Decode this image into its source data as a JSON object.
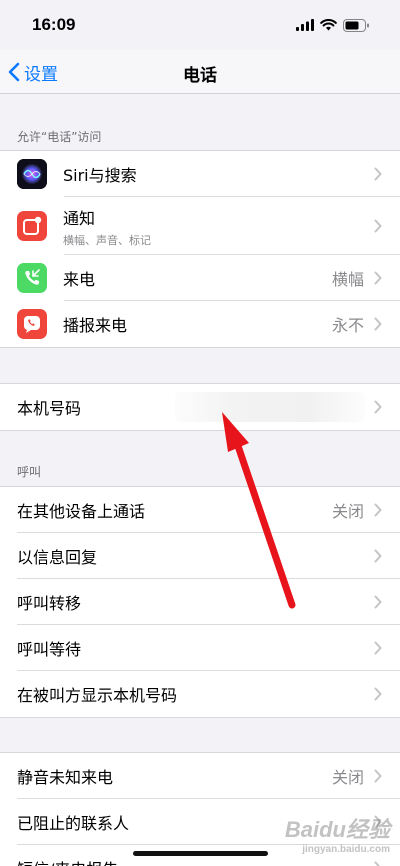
{
  "status_bar": {
    "time": "16:09"
  },
  "nav": {
    "back_label": "设置",
    "title": "电话"
  },
  "section_allow": {
    "header": "允许“电话”访问",
    "rows": [
      {
        "label": "Siri与搜索",
        "icon": "siri-icon"
      },
      {
        "label": "通知",
        "subtitle": "横幅、声音、标记",
        "icon": "notification-icon"
      },
      {
        "label": "来电",
        "value": "横幅",
        "icon": "incoming-call-icon"
      },
      {
        "label": "播报来电",
        "value": "永不",
        "icon": "announce-calls-icon"
      }
    ]
  },
  "my_number": {
    "label": "本机号码"
  },
  "section_call": {
    "header": "呼叫",
    "rows": [
      {
        "label": "在其他设备上通话",
        "value": "关闭"
      },
      {
        "label": "以信息回复"
      },
      {
        "label": "呼叫转移"
      },
      {
        "label": "呼叫等待"
      },
      {
        "label": "在被叫方显示本机号码"
      }
    ]
  },
  "section_misc": {
    "rows": [
      {
        "label": "静音未知来电",
        "value": "关闭"
      },
      {
        "label": "已阻止的联系人"
      },
      {
        "label": "短信/来电报告"
      }
    ]
  },
  "watermark": {
    "brand": "Baidu经验",
    "url": "jingyan.baidu.com"
  },
  "colors": {
    "accent": "#0a7aff",
    "arrow": "#e8141b",
    "background": "#f2f2f7"
  }
}
